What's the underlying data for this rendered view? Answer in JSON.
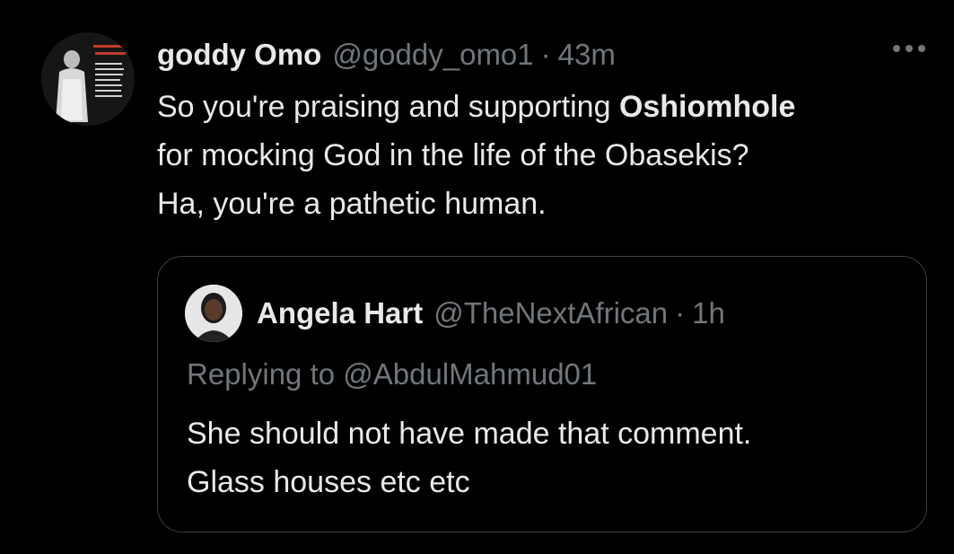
{
  "tweet": {
    "display_name": "goddy Omo",
    "handle": "@goddy_omo1",
    "separator": "·",
    "time": "43m",
    "text_part1": "So you're praising and supporting ",
    "text_bold": "Oshiomhole",
    "text_line2": "for mocking God in the life of the Obasekis?",
    "text_line3": "Ha, you're a pathetic human.",
    "more_icon": "more-horizontal-icon"
  },
  "quoted_tweet": {
    "display_name": "Angela Hart",
    "handle": "@TheNextAfrican",
    "separator": "·",
    "time": "1h",
    "reply_prefix": "Replying to ",
    "reply_mention": "@AbdulMahmud01",
    "text_line1": "She should not have made that comment.",
    "text_line2": "Glass houses etc etc"
  },
  "colors": {
    "background": "#000000",
    "primary_text": "#e7e9ea",
    "secondary_text": "#71767b",
    "border": "#3b3f44"
  }
}
